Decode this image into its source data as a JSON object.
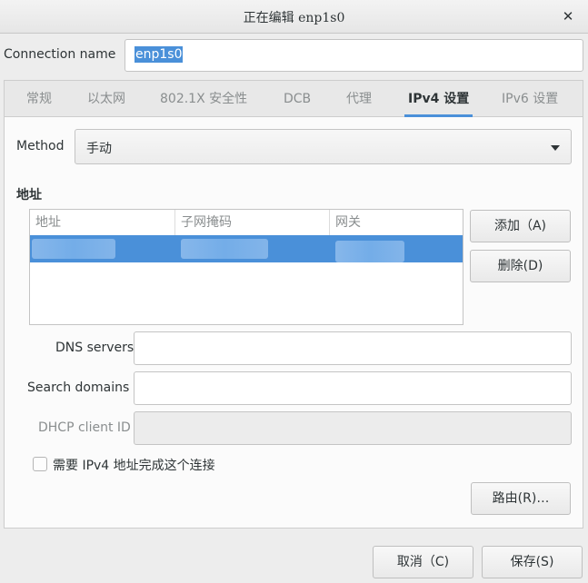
{
  "window": {
    "title": "正在编辑 enp1s0",
    "close_glyph": "✕"
  },
  "connection": {
    "label": "Connection name",
    "value": "enp1s0"
  },
  "tabs": [
    {
      "label": "常规",
      "active": false
    },
    {
      "label": "以太网",
      "active": false
    },
    {
      "label": "802.1X 安全性",
      "active": false
    },
    {
      "label": "DCB",
      "active": false
    },
    {
      "label": "代理",
      "active": false
    },
    {
      "label": "IPv4 设置",
      "active": true
    },
    {
      "label": "IPv6 设置",
      "active": false
    }
  ],
  "ipv4": {
    "method_label": "Method",
    "method_value": "手动",
    "addresses_heading": "地址",
    "columns": [
      "地址",
      "子网掩码",
      "网关"
    ],
    "add_button": "添加（A)",
    "delete_button": "删除(D)",
    "dns_label": "DNS servers",
    "dns_value": "",
    "search_label": "Search domains",
    "search_value": "",
    "dhcp_label": "DHCP client ID",
    "dhcp_value": "",
    "require_checkbox_label": "需要 IPv4 地址完成这个连接",
    "require_checked": false,
    "routes_button": "路由(R)…"
  },
  "footer": {
    "cancel_button": "取消（C)",
    "save_button": "保存(S)"
  },
  "colors": {
    "accent": "#4a90d9",
    "background": "#ededed"
  }
}
